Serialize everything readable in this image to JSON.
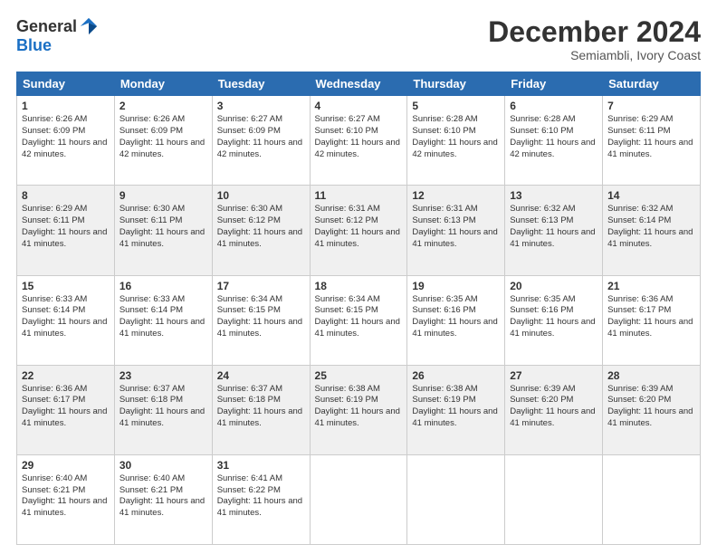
{
  "logo": {
    "general": "General",
    "blue": "Blue"
  },
  "header": {
    "month": "December 2024",
    "location": "Semiambli, Ivory Coast"
  },
  "days_of_week": [
    "Sunday",
    "Monday",
    "Tuesday",
    "Wednesday",
    "Thursday",
    "Friday",
    "Saturday"
  ],
  "weeks": [
    [
      {
        "day": "1",
        "sunrise": "6:26 AM",
        "sunset": "6:09 PM",
        "daylight": "11 hours and 42 minutes."
      },
      {
        "day": "2",
        "sunrise": "6:26 AM",
        "sunset": "6:09 PM",
        "daylight": "11 hours and 42 minutes."
      },
      {
        "day": "3",
        "sunrise": "6:27 AM",
        "sunset": "6:09 PM",
        "daylight": "11 hours and 42 minutes."
      },
      {
        "day": "4",
        "sunrise": "6:27 AM",
        "sunset": "6:10 PM",
        "daylight": "11 hours and 42 minutes."
      },
      {
        "day": "5",
        "sunrise": "6:28 AM",
        "sunset": "6:10 PM",
        "daylight": "11 hours and 42 minutes."
      },
      {
        "day": "6",
        "sunrise": "6:28 AM",
        "sunset": "6:10 PM",
        "daylight": "11 hours and 42 minutes."
      },
      {
        "day": "7",
        "sunrise": "6:29 AM",
        "sunset": "6:11 PM",
        "daylight": "11 hours and 41 minutes."
      }
    ],
    [
      {
        "day": "8",
        "sunrise": "6:29 AM",
        "sunset": "6:11 PM",
        "daylight": "11 hours and 41 minutes."
      },
      {
        "day": "9",
        "sunrise": "6:30 AM",
        "sunset": "6:11 PM",
        "daylight": "11 hours and 41 minutes."
      },
      {
        "day": "10",
        "sunrise": "6:30 AM",
        "sunset": "6:12 PM",
        "daylight": "11 hours and 41 minutes."
      },
      {
        "day": "11",
        "sunrise": "6:31 AM",
        "sunset": "6:12 PM",
        "daylight": "11 hours and 41 minutes."
      },
      {
        "day": "12",
        "sunrise": "6:31 AM",
        "sunset": "6:13 PM",
        "daylight": "11 hours and 41 minutes."
      },
      {
        "day": "13",
        "sunrise": "6:32 AM",
        "sunset": "6:13 PM",
        "daylight": "11 hours and 41 minutes."
      },
      {
        "day": "14",
        "sunrise": "6:32 AM",
        "sunset": "6:14 PM",
        "daylight": "11 hours and 41 minutes."
      }
    ],
    [
      {
        "day": "15",
        "sunrise": "6:33 AM",
        "sunset": "6:14 PM",
        "daylight": "11 hours and 41 minutes."
      },
      {
        "day": "16",
        "sunrise": "6:33 AM",
        "sunset": "6:14 PM",
        "daylight": "11 hours and 41 minutes."
      },
      {
        "day": "17",
        "sunrise": "6:34 AM",
        "sunset": "6:15 PM",
        "daylight": "11 hours and 41 minutes."
      },
      {
        "day": "18",
        "sunrise": "6:34 AM",
        "sunset": "6:15 PM",
        "daylight": "11 hours and 41 minutes."
      },
      {
        "day": "19",
        "sunrise": "6:35 AM",
        "sunset": "6:16 PM",
        "daylight": "11 hours and 41 minutes."
      },
      {
        "day": "20",
        "sunrise": "6:35 AM",
        "sunset": "6:16 PM",
        "daylight": "11 hours and 41 minutes."
      },
      {
        "day": "21",
        "sunrise": "6:36 AM",
        "sunset": "6:17 PM",
        "daylight": "11 hours and 41 minutes."
      }
    ],
    [
      {
        "day": "22",
        "sunrise": "6:36 AM",
        "sunset": "6:17 PM",
        "daylight": "11 hours and 41 minutes."
      },
      {
        "day": "23",
        "sunrise": "6:37 AM",
        "sunset": "6:18 PM",
        "daylight": "11 hours and 41 minutes."
      },
      {
        "day": "24",
        "sunrise": "6:37 AM",
        "sunset": "6:18 PM",
        "daylight": "11 hours and 41 minutes."
      },
      {
        "day": "25",
        "sunrise": "6:38 AM",
        "sunset": "6:19 PM",
        "daylight": "11 hours and 41 minutes."
      },
      {
        "day": "26",
        "sunrise": "6:38 AM",
        "sunset": "6:19 PM",
        "daylight": "11 hours and 41 minutes."
      },
      {
        "day": "27",
        "sunrise": "6:39 AM",
        "sunset": "6:20 PM",
        "daylight": "11 hours and 41 minutes."
      },
      {
        "day": "28",
        "sunrise": "6:39 AM",
        "sunset": "6:20 PM",
        "daylight": "11 hours and 41 minutes."
      }
    ],
    [
      {
        "day": "29",
        "sunrise": "6:40 AM",
        "sunset": "6:21 PM",
        "daylight": "11 hours and 41 minutes."
      },
      {
        "day": "30",
        "sunrise": "6:40 AM",
        "sunset": "6:21 PM",
        "daylight": "11 hours and 41 minutes."
      },
      {
        "day": "31",
        "sunrise": "6:41 AM",
        "sunset": "6:22 PM",
        "daylight": "11 hours and 41 minutes."
      },
      null,
      null,
      null,
      null
    ]
  ]
}
